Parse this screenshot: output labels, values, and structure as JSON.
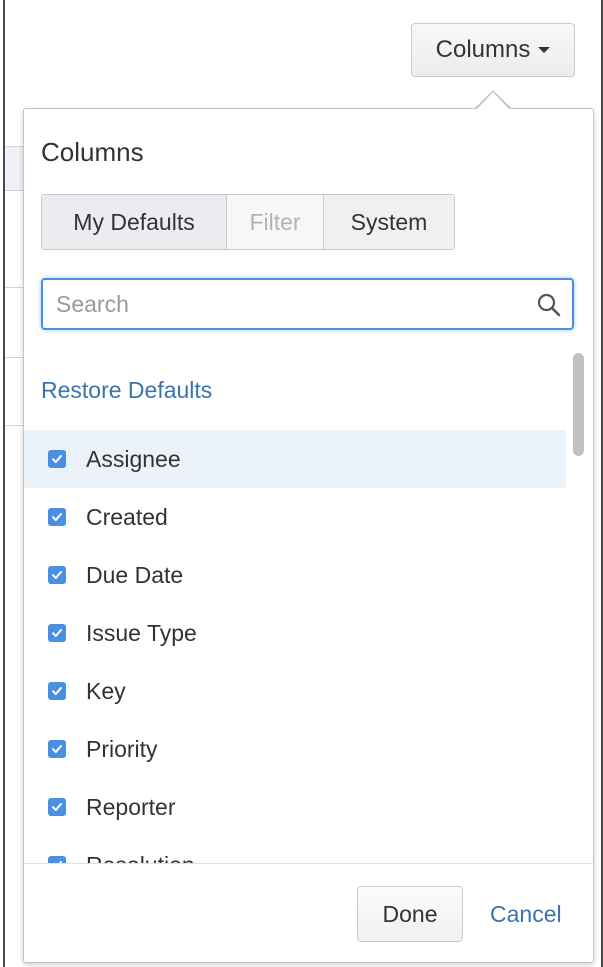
{
  "trigger": {
    "label": "Columns",
    "icon": "caret-down-icon"
  },
  "popup": {
    "title": "Columns",
    "tabs": [
      {
        "label": "My Defaults",
        "state": "selected"
      },
      {
        "label": "Filter",
        "state": "disabled"
      },
      {
        "label": "System",
        "state": "normal"
      }
    ],
    "search": {
      "placeholder": "Search",
      "value": "",
      "icon": "search-icon"
    },
    "restore_label": "Restore Defaults",
    "items": [
      {
        "label": "Assignee",
        "checked": true,
        "highlighted": true
      },
      {
        "label": "Created",
        "checked": true
      },
      {
        "label": "Due Date",
        "checked": true
      },
      {
        "label": "Issue Type",
        "checked": true
      },
      {
        "label": "Key",
        "checked": true
      },
      {
        "label": "Priority",
        "checked": true
      },
      {
        "label": "Reporter",
        "checked": true
      },
      {
        "label": "Resolution",
        "checked": true
      }
    ],
    "footer": {
      "done_label": "Done",
      "cancel_label": "Cancel"
    }
  },
  "colors": {
    "accent": "#4a90e2",
    "link": "#3b73af",
    "highlight": "#ebf2f9"
  }
}
